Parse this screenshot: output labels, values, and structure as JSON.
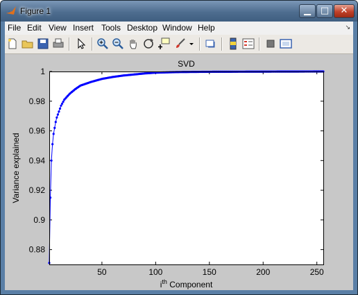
{
  "window": {
    "title": "Figure 1"
  },
  "menu": {
    "items": [
      "File",
      "Edit",
      "View",
      "Insert",
      "Tools",
      "Desktop",
      "Window",
      "Help"
    ]
  },
  "toolbar": {
    "icons": [
      "new-figure-icon",
      "open-file-icon",
      "save-icon",
      "print-icon",
      "select-arrow-icon",
      "zoom-in-icon",
      "zoom-out-icon",
      "pan-hand-icon",
      "rotate-3d-icon",
      "data-cursor-icon",
      "brush-icon",
      "brush-dropdown-icon",
      "link-plot-icon",
      "colorbar-icon",
      "legend-icon",
      "hide-plot-tools-icon",
      "show-plot-tools-icon"
    ]
  },
  "chart_data": {
    "type": "line",
    "title": "SVD",
    "xlabel_base": "i",
    "xlabel_sup": "th",
    "xlabel_rest": " Component",
    "ylabel": "Variance explained",
    "xlim": [
      1,
      256
    ],
    "ylim": [
      0.87,
      1.0
    ],
    "xticks": [
      50,
      100,
      150,
      200,
      250
    ],
    "yticks": [
      0.88,
      0.9,
      0.92,
      0.94,
      0.96,
      0.98,
      1
    ],
    "ytick_labels": [
      "0.88",
      "0.9",
      "0.92",
      "0.94",
      "0.96",
      "0.98",
      "1"
    ],
    "xtick_labels": [
      "50",
      "100",
      "150",
      "200",
      "250"
    ],
    "grid": false,
    "series": [
      {
        "color": "#0000ff",
        "marker": "dot",
        "x_start": 1,
        "x_end": 256,
        "points": [
          [
            1,
            0.871
          ],
          [
            2,
            0.915
          ],
          [
            3,
            0.94
          ],
          [
            4,
            0.951
          ],
          [
            5,
            0.958
          ],
          [
            6,
            0.962
          ],
          [
            7,
            0.966
          ],
          [
            8,
            0.969
          ],
          [
            10,
            0.973
          ],
          [
            12,
            0.977
          ],
          [
            15,
            0.981
          ],
          [
            20,
            0.985
          ],
          [
            25,
            0.988
          ],
          [
            30,
            0.9905
          ],
          [
            40,
            0.993
          ],
          [
            50,
            0.995
          ],
          [
            60,
            0.9963
          ],
          [
            70,
            0.9973
          ],
          [
            80,
            0.998
          ],
          [
            90,
            0.9987
          ],
          [
            100,
            0.9992
          ],
          [
            120,
            0.9996
          ],
          [
            150,
            0.9998
          ],
          [
            200,
            0.9999
          ],
          [
            256,
            1.0
          ]
        ]
      }
    ]
  }
}
